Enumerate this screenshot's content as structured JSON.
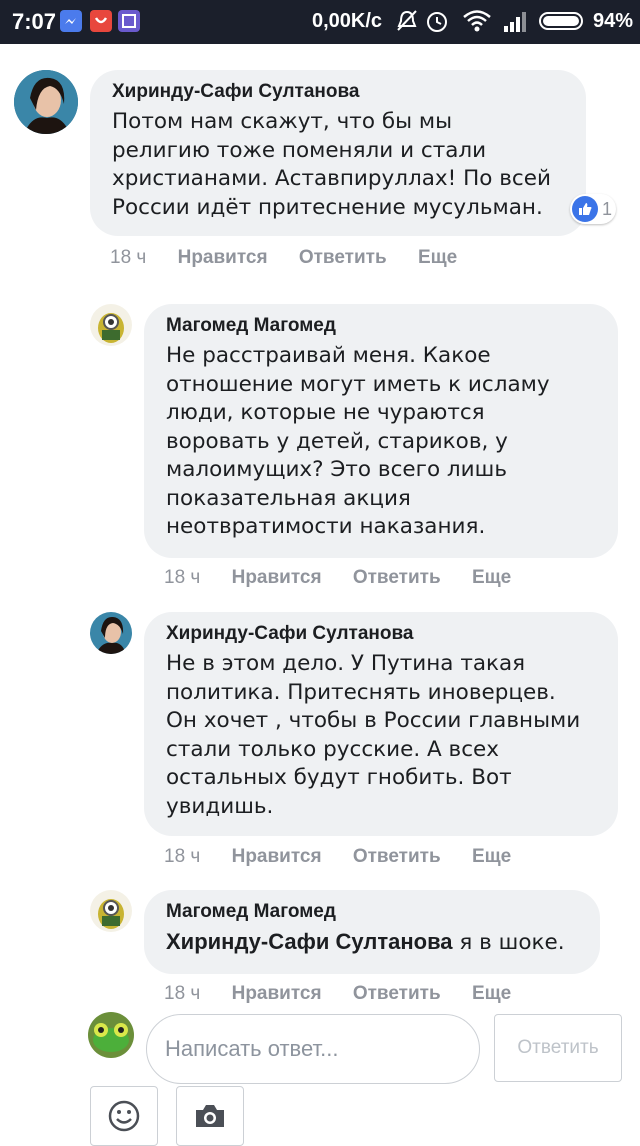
{
  "status_bar": {
    "time": "7:07",
    "speed": "0,00K/c",
    "battery": "94%"
  },
  "comments": [
    {
      "author": "Хиринду-Сафи Султанова",
      "lines": [
        "Потом нам скажут, что бы мы",
        "религию тоже поменяли и стали",
        "христианами. Аставпируллах! По всей",
        "России идёт притеснение мусульман."
      ],
      "time": "18 ч",
      "reactions": "1"
    },
    {
      "author": "Магомед Магомед",
      "lines": [
        "Не расстраивай меня. Какое",
        "отношение могут иметь к исламу",
        "люди, которые не чураются",
        "воровать у детей, стариков, у",
        "малоимущих? Это всего лишь",
        "показательная акция",
        "неотвратимости наказания."
      ],
      "time": "18 ч"
    },
    {
      "author": "Хиринду-Сафи Султанова",
      "lines": [
        "Не в этом дело. У Путина такая",
        "политика. Притеснять иноверцев.",
        "Он хочет , чтобы в России главными",
        "стали только русские. А всех",
        "остальных будут гнобить. Вот",
        "увидишь."
      ],
      "time": "18 ч"
    },
    {
      "author": "Магомед Магомед",
      "mention": "Хиринду-Сафи Султанова",
      "text": " я в шоке.",
      "time": "18 ч"
    }
  ],
  "actions": {
    "like": "Нравится",
    "reply": "Ответить",
    "more": "Еще"
  },
  "reply_box": {
    "placeholder": "Написать ответ...",
    "button": "Ответить"
  },
  "icons": [
    "messenger-icon",
    "app-icon",
    "gallery-icon",
    "mute-icon",
    "alarm-icon",
    "wifi-icon",
    "signal-icon",
    "battery-icon",
    "like-icon",
    "emoji-icon",
    "camera-icon"
  ],
  "colors": {
    "status_bar": "#1b1f2b",
    "bubble": "#eff1f3",
    "meta": "#90949c",
    "like_blue": "#3b74e8"
  }
}
